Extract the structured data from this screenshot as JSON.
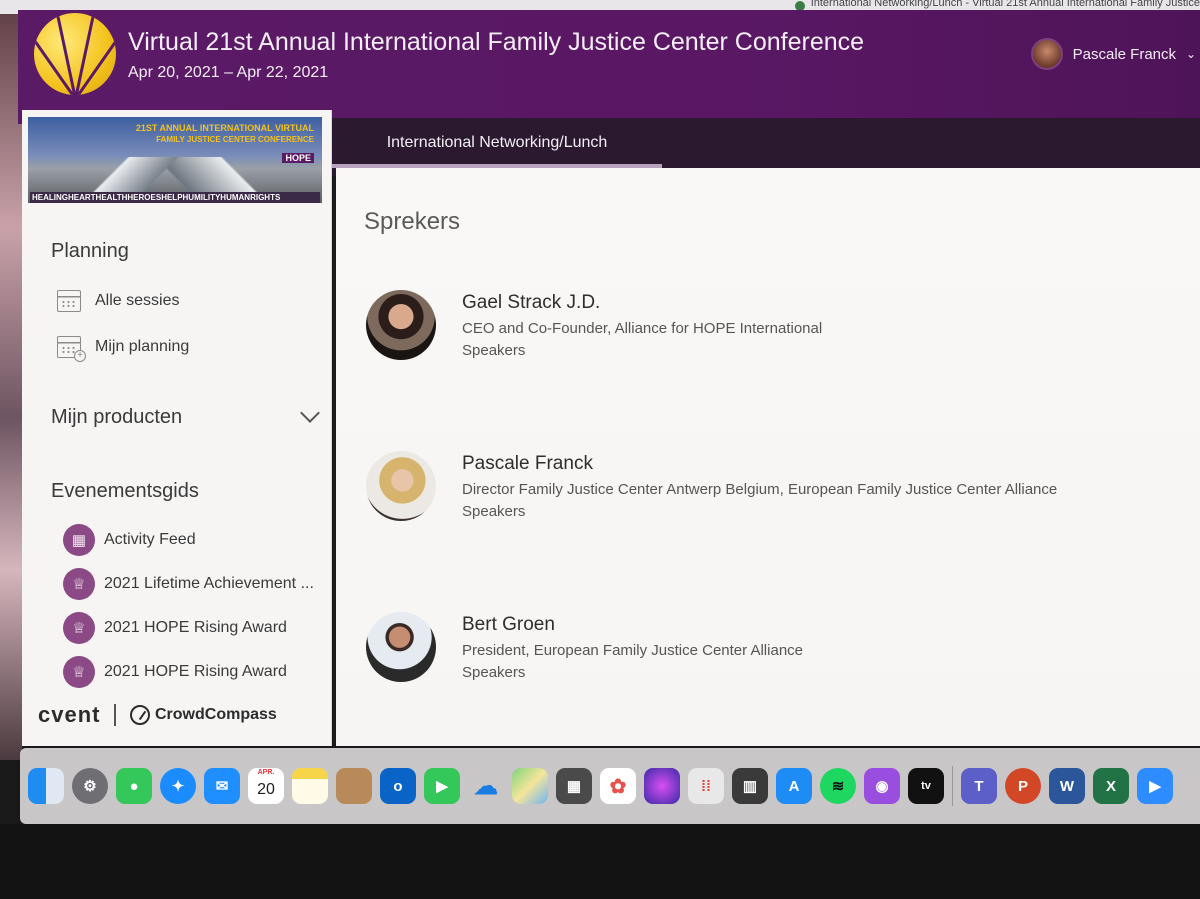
{
  "browser": {
    "tab_title": "International Networking/Lunch - Virtual 21st Annual International Family Justice"
  },
  "header": {
    "title": "Virtual 21st Annual International Family Justice Center Conference",
    "dates": "Apr 20, 2021 – Apr 22, 2021",
    "user_name": "Pascale Franck",
    "colors": {
      "header_bg": "#5b1a66",
      "logo": "#f3c21c"
    }
  },
  "sidebar": {
    "banner": {
      "line1": "21ST ANNUAL INTERNATIONAL VIRTUAL",
      "line2": "FAMILY JUSTICE CENTER CONFERENCE",
      "badge": "HOPE",
      "words": "HEALINGHEARTHEALTHHEROESHELPHUMILITYHUMANRIGHTS"
    },
    "planning": {
      "heading": "Planning",
      "items": [
        {
          "label": "Alle sessies",
          "icon": "calendar-icon"
        },
        {
          "label": "Mijn planning",
          "icon": "calendar-add-icon"
        }
      ]
    },
    "products": {
      "heading": "Mijn producten",
      "icon": "chevron-down-icon"
    },
    "guide": {
      "heading": "Evenementsgids",
      "items": [
        {
          "label": "Activity Feed",
          "icon": "activity-feed-icon"
        },
        {
          "label": "2021 Lifetime Achievement ...",
          "icon": "trophy-icon"
        },
        {
          "label": "2021 HOPE Rising Award",
          "icon": "trophy-icon"
        },
        {
          "label": "2021 HOPE Rising Award",
          "icon": "trophy-icon"
        }
      ]
    },
    "footer": {
      "cvent": "cvent",
      "crowdcompass": "CrowdCompass"
    }
  },
  "main": {
    "tab": "International Networking/Lunch",
    "section_title": "Sprekers",
    "speakers": [
      {
        "name": "Gael Strack J.D.",
        "role": "CEO and Co-Founder, Alliance for HOPE International",
        "group": "Speakers"
      },
      {
        "name": "Pascale Franck",
        "role": "Director Family Justice Center Antwerp Belgium, European Family Justice Center Alliance",
        "group": "Speakers"
      },
      {
        "name": "Bert Groen",
        "role": "President, European Family Justice Center Alliance",
        "group": "Speakers"
      }
    ]
  },
  "dock": {
    "calendar_month": "APR.",
    "calendar_day": "20",
    "apps": [
      "finder-icon",
      "system-preferences-icon",
      "messages-icon",
      "safari-icon",
      "mail-icon",
      "calendar-icon",
      "notes-icon",
      "contacts-icon",
      "outlook-icon",
      "facetime-icon",
      "onedrive-icon",
      "maps-icon",
      "calculator-icon",
      "photos-icon",
      "siri-icon",
      "launchpad-icon",
      "mission-control-icon",
      "app-store-icon",
      "spotify-icon",
      "podcasts-icon",
      "apple-tv-icon",
      "teams-icon",
      "powerpoint-icon",
      "word-icon",
      "excel-icon",
      "zoom-icon"
    ],
    "labels": {
      "outlook": "o",
      "word": "W",
      "excel": "X",
      "powerpoint": "P",
      "tv": "tv"
    }
  }
}
